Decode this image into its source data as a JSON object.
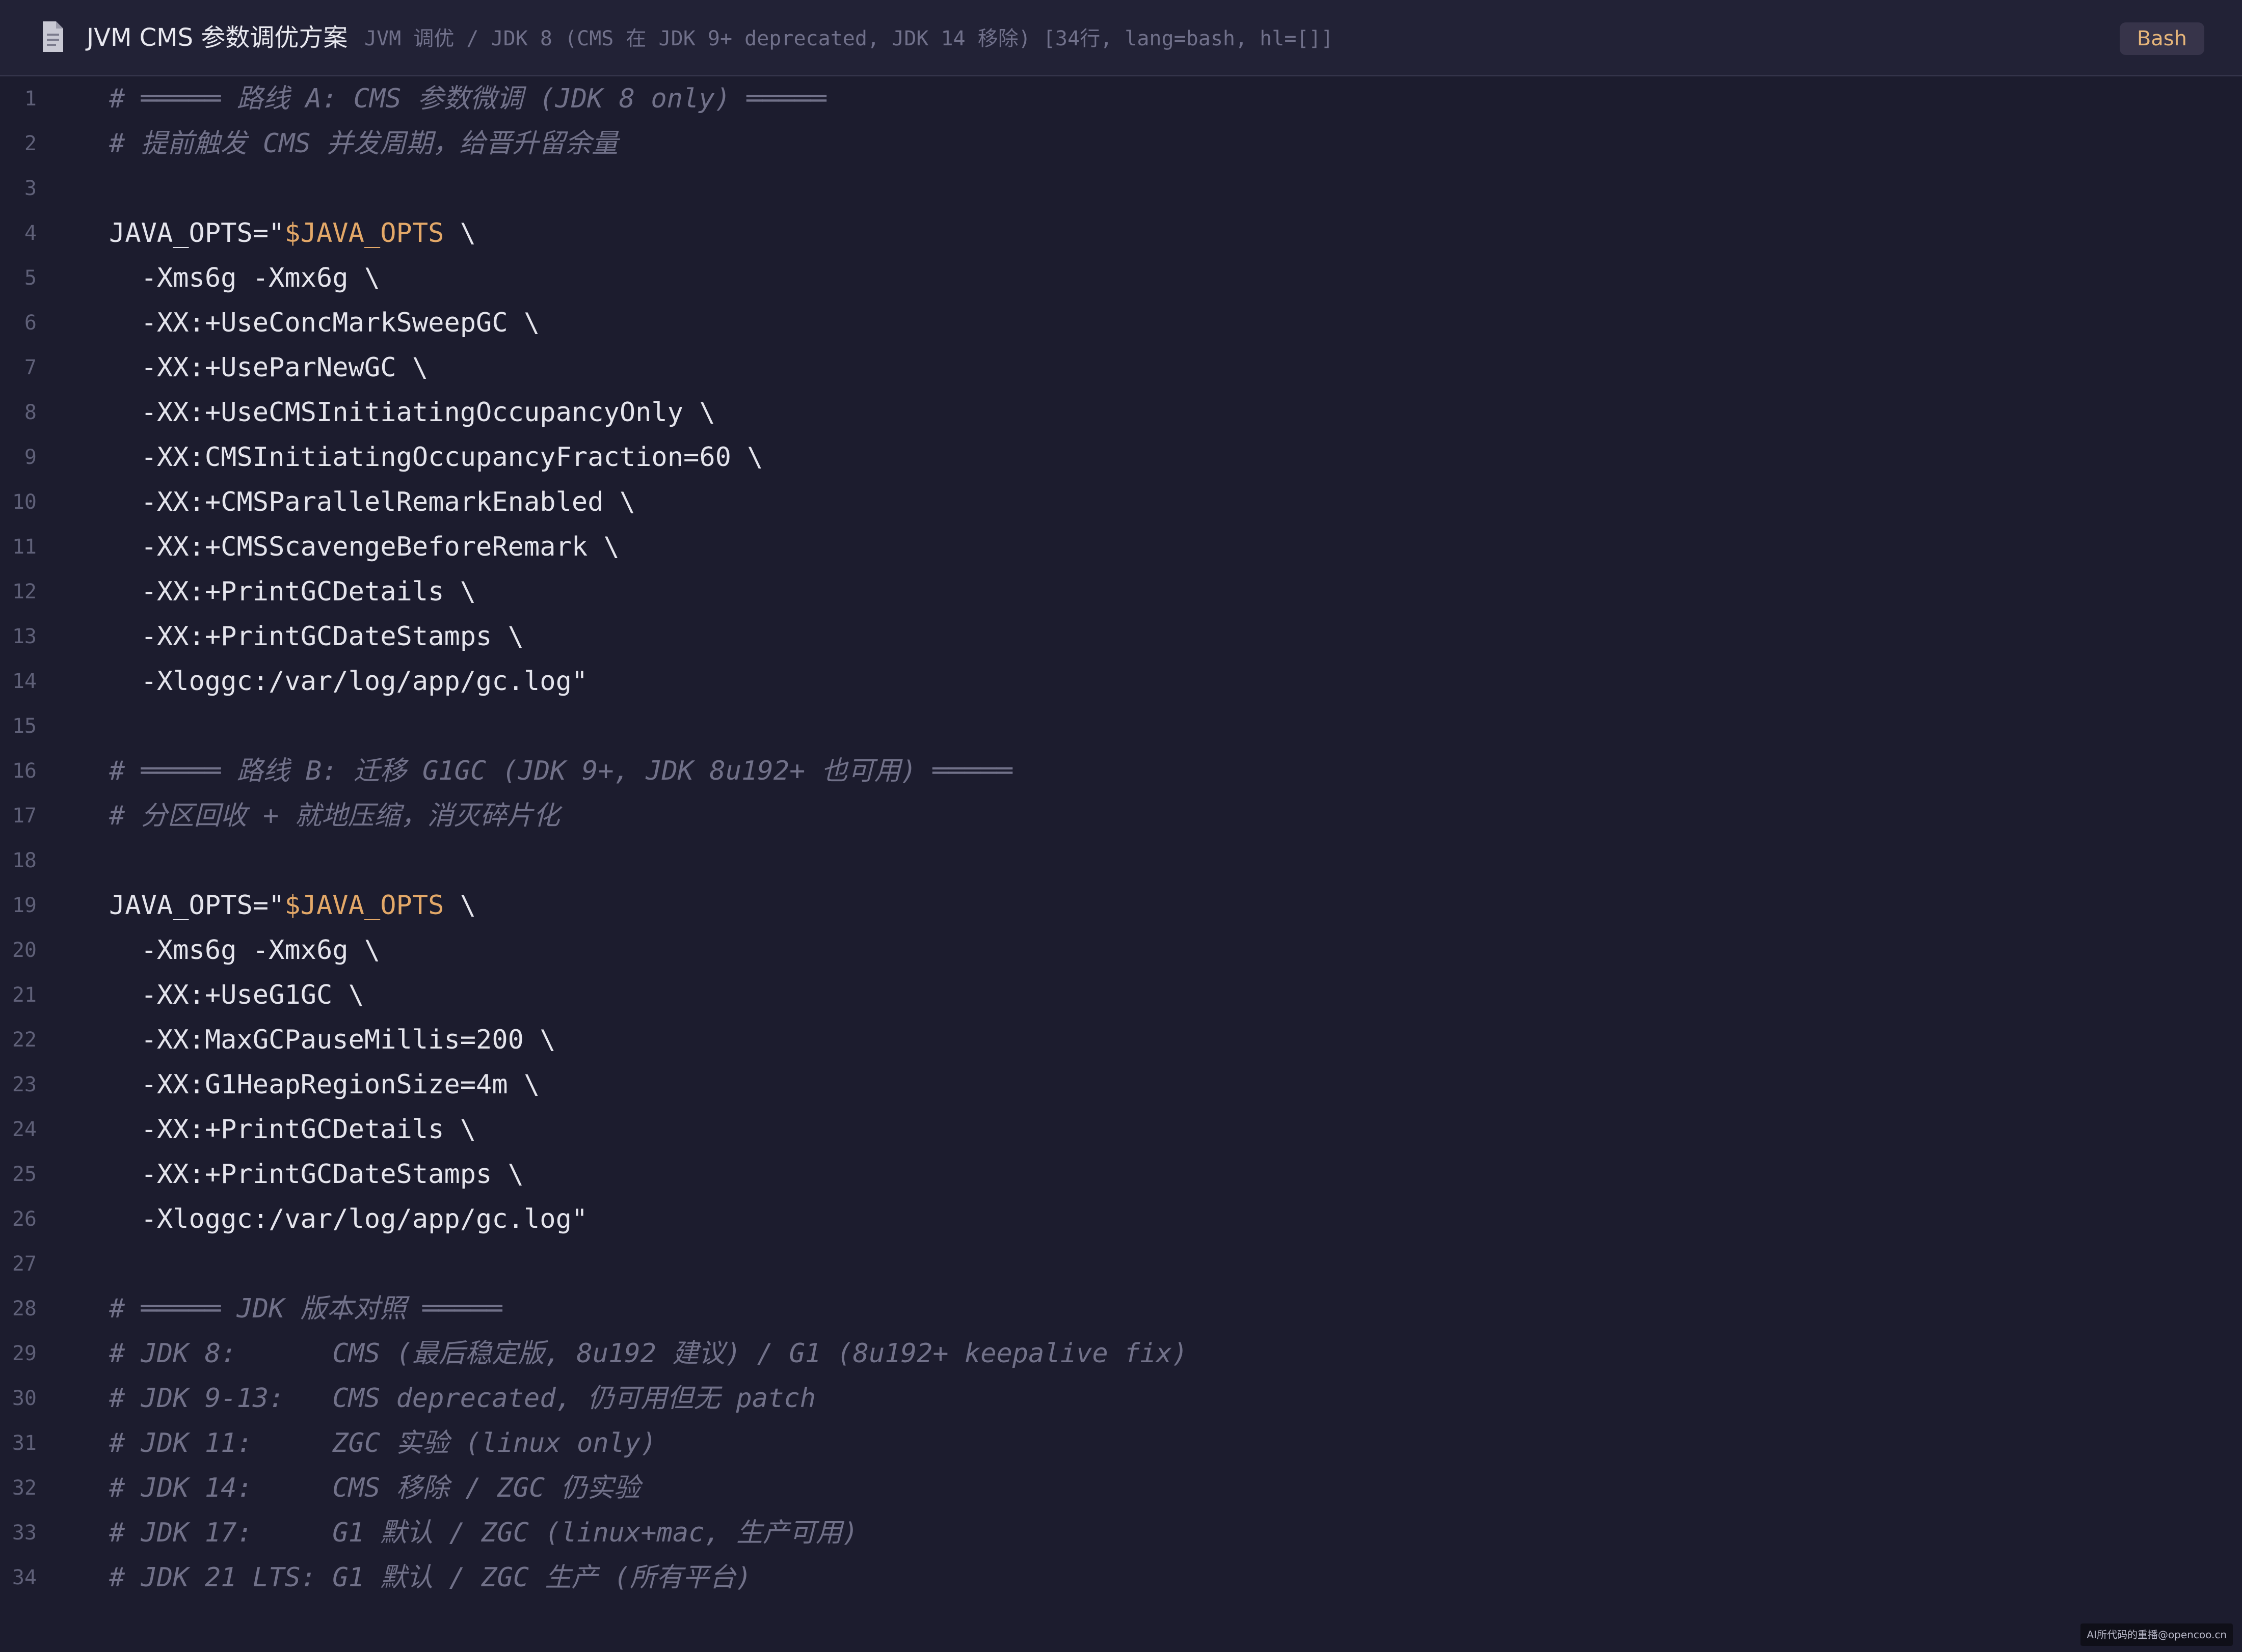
{
  "header": {
    "icon": "document-icon",
    "title": "JVM CMS 参数调优方案",
    "subtitle": "JVM 调优 / JDK 8 (CMS 在 JDK 9+ deprecated, JDK 14 移除)  [34行, lang=bash, hl=[]]",
    "language_badge": "Bash"
  },
  "colors": {
    "background": "#1c1c2e",
    "header_background": "#222236",
    "code_text": "#e4e4ec",
    "comment": "#717189",
    "variable": "#e3a868",
    "line_number": "#5f6078",
    "badge_text": "#e6b57a"
  },
  "code": {
    "lines": [
      {
        "n": "1",
        "type": "comment",
        "text": "# ═════ 路线 A: CMS 参数微调 (JDK 8 only) ═════"
      },
      {
        "n": "2",
        "type": "comment",
        "text": "# 提前触发 CMS 并发周期，给晋升留余量"
      },
      {
        "n": "3",
        "type": "blank",
        "text": ""
      },
      {
        "n": "4",
        "type": "code",
        "prefix": "JAVA_OPTS=\"",
        "var": "$JAVA_OPTS",
        "suffix": " \\"
      },
      {
        "n": "5",
        "type": "code",
        "text": "  -Xms6g -Xmx6g \\"
      },
      {
        "n": "6",
        "type": "code",
        "text": "  -XX:+UseConcMarkSweepGC \\"
      },
      {
        "n": "7",
        "type": "code",
        "text": "  -XX:+UseParNewGC \\"
      },
      {
        "n": "8",
        "type": "code",
        "text": "  -XX:+UseCMSInitiatingOccupancyOnly \\"
      },
      {
        "n": "9",
        "type": "code",
        "text": "  -XX:CMSInitiatingOccupancyFraction=60 \\"
      },
      {
        "n": "10",
        "type": "code",
        "text": "  -XX:+CMSParallelRemarkEnabled \\"
      },
      {
        "n": "11",
        "type": "code",
        "text": "  -XX:+CMSScavengeBeforeRemark \\"
      },
      {
        "n": "12",
        "type": "code",
        "text": "  -XX:+PrintGCDetails \\"
      },
      {
        "n": "13",
        "type": "code",
        "text": "  -XX:+PrintGCDateStamps \\"
      },
      {
        "n": "14",
        "type": "code",
        "text": "  -Xloggc:/var/log/app/gc.log\""
      },
      {
        "n": "15",
        "type": "blank",
        "text": ""
      },
      {
        "n": "16",
        "type": "comment",
        "text": "# ═════ 路线 B: 迁移 G1GC (JDK 9+, JDK 8u192+ 也可用) ═════"
      },
      {
        "n": "17",
        "type": "comment",
        "text": "# 分区回收 + 就地压缩，消灭碎片化"
      },
      {
        "n": "18",
        "type": "blank",
        "text": ""
      },
      {
        "n": "19",
        "type": "code",
        "prefix": "JAVA_OPTS=\"",
        "var": "$JAVA_OPTS",
        "suffix": " \\"
      },
      {
        "n": "20",
        "type": "code",
        "text": "  -Xms6g -Xmx6g \\"
      },
      {
        "n": "21",
        "type": "code",
        "text": "  -XX:+UseG1GC \\"
      },
      {
        "n": "22",
        "type": "code",
        "text": "  -XX:MaxGCPauseMillis=200 \\"
      },
      {
        "n": "23",
        "type": "code",
        "text": "  -XX:G1HeapRegionSize=4m \\"
      },
      {
        "n": "24",
        "type": "code",
        "text": "  -XX:+PrintGCDetails \\"
      },
      {
        "n": "25",
        "type": "code",
        "text": "  -XX:+PrintGCDateStamps \\"
      },
      {
        "n": "26",
        "type": "code",
        "text": "  -Xloggc:/var/log/app/gc.log\""
      },
      {
        "n": "27",
        "type": "blank",
        "text": ""
      },
      {
        "n": "28",
        "type": "comment",
        "text": "# ═════ JDK 版本对照 ═════"
      },
      {
        "n": "29",
        "type": "comment",
        "text": "# JDK 8:      CMS (最后稳定版, 8u192 建议) / G1 (8u192+ keepalive fix)"
      },
      {
        "n": "30",
        "type": "comment",
        "text": "# JDK 9-13:   CMS deprecated, 仍可用但无 patch"
      },
      {
        "n": "31",
        "type": "comment",
        "text": "# JDK 11:     ZGC 实验 (linux only)"
      },
      {
        "n": "32",
        "type": "comment",
        "text": "# JDK 14:     CMS 移除 / ZGC 仍实验"
      },
      {
        "n": "33",
        "type": "comment",
        "text": "# JDK 17:     G1 默认 / ZGC (linux+mac, 生产可用)"
      },
      {
        "n": "34",
        "type": "comment",
        "text": "# JDK 21 LTS: G1 默认 / ZGC 生产 (所有平台)"
      }
    ]
  },
  "watermark": "AI所代码的重播@opencoo.cn"
}
